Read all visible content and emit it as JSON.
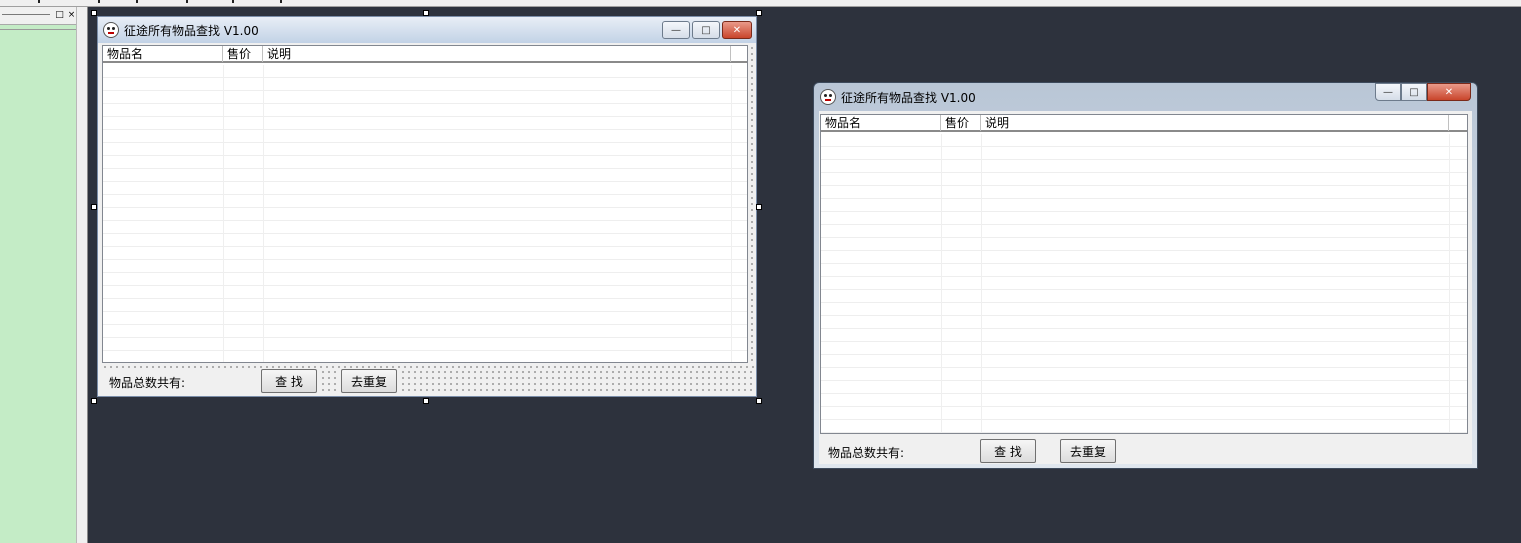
{
  "designer": {
    "title": "征途所有物品查找 V1.00",
    "columns": [
      "物品名",
      "售价",
      "说明"
    ],
    "count_label": "物品总数共有:",
    "search_button": "查 找",
    "dedupe_button": "去重复"
  },
  "preview": {
    "title": "征途所有物品查找 V1.00",
    "columns": [
      "物品名",
      "售价",
      "说明"
    ],
    "count_label": "物品总数共有:",
    "search_button": "查 找",
    "dedupe_button": "去重复"
  },
  "dock": {
    "restore_glyph": "□",
    "close_glyph": "×"
  },
  "caption": {
    "minimize": "—",
    "maximize": "□",
    "close": "✕"
  },
  "icons": {
    "app": "app-face-icon"
  }
}
